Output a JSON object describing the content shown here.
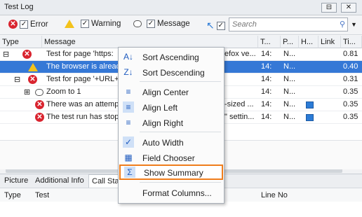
{
  "window": {
    "title": "Test Log"
  },
  "toolbar": {
    "error_label": "Error",
    "warning_label": "Warning",
    "message_label": "Message",
    "search_placeholder": "Search"
  },
  "grid": {
    "headers": [
      "Type",
      "Message",
      "T...",
      "P...",
      "H...",
      "Link",
      "Ti..."
    ],
    "rows": [
      {
        "message": "Test for page 'https:",
        "message_tail": "efox ve...",
        "t": "14:",
        "p": "N...",
        "ti": "0.81"
      },
      {
        "message": "The browser is alread",
        "t": "14:",
        "p": "N...",
        "ti": "0.40"
      },
      {
        "message": "Test for page '+URL+",
        "t": "14:",
        "p": "N...",
        "ti": "0.31"
      },
      {
        "message": "Zoom to 1",
        "t": "14:",
        "p": "N...",
        "ti": "0.35"
      },
      {
        "message": "There was an attemp",
        "message_tail": "-sized ...",
        "t": "14:",
        "p": "N...",
        "ti": "0.35"
      },
      {
        "message": "The test run has stop",
        "message_tail": "\" settin...",
        "t": "14:",
        "p": "N...",
        "ti": "0.35"
      }
    ]
  },
  "context_menu": {
    "items": [
      {
        "label": "Sort Ascending",
        "icon": "sort-ascending-icon"
      },
      {
        "label": "Sort Descending",
        "icon": "sort-descending-icon"
      },
      {
        "label": "Align Center",
        "icon": "align-center-icon"
      },
      {
        "label": "Align Left",
        "icon": "align-left-icon"
      },
      {
        "label": "Align Right",
        "icon": "align-right-icon"
      },
      {
        "label": "Auto Width",
        "icon": "check-icon"
      },
      {
        "label": "Field Chooser",
        "icon": "field-chooser-icon"
      },
      {
        "label": "Show Summary",
        "icon": "sigma-icon"
      },
      {
        "label": "Format Columns...",
        "icon": ""
      }
    ],
    "highlight_color": "#ef7d1c"
  },
  "bottom_tabs": [
    "Picture",
    "Additional Info",
    "Call Sta"
  ],
  "bottom_headers": [
    "Type",
    "Test",
    "Line No"
  ]
}
